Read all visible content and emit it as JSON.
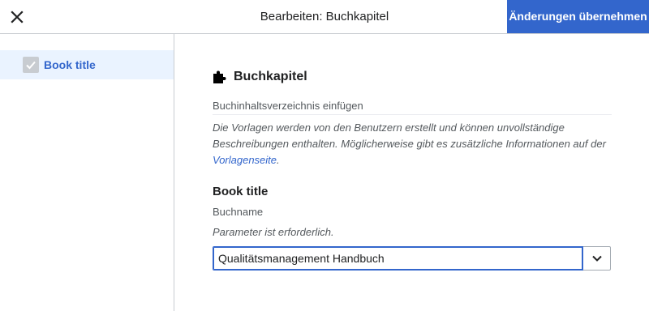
{
  "header": {
    "title": "Bearbeiten: Buchkapitel",
    "apply_label": "Änderungen übernehmen",
    "close_icon": "close-icon"
  },
  "sidebar": {
    "items": [
      {
        "label": "Book title",
        "checked": true
      }
    ]
  },
  "template": {
    "name": "Buchkapitel",
    "icon": "puzzle-icon",
    "description": "Buchinhaltsverzeichnis einfügen",
    "note_text": "Die Vorlagen werden von den Benutzern erstellt und können unvollständige Beschreibungen enthalten. Möglicherweise gibt es zusätzliche Informationen auf der ",
    "note_link": "Vorlagenseite",
    "note_end": "."
  },
  "parameter": {
    "label": "Book title",
    "description": "Buchname",
    "required_text": "Parameter ist erforderlich.",
    "value": "Qualitätsmanagement Handbuch"
  },
  "colors": {
    "accent": "#3366cc",
    "selected_bg": "#eaf3ff",
    "border": "#c8ccd1"
  }
}
